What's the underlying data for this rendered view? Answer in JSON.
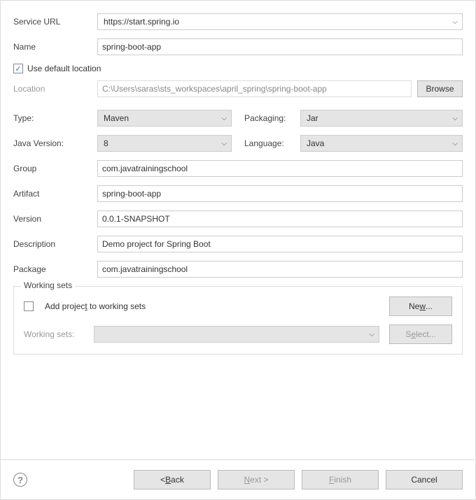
{
  "labels": {
    "serviceUrl": "Service URL",
    "name": "Name",
    "useDefaultLocation": "Use default location",
    "location": "Location",
    "browse": "Browse",
    "type": "Type:",
    "packaging": "Packaging:",
    "javaVersion": "Java Version:",
    "language": "Language:",
    "group": "Group",
    "artifact": "Artifact",
    "version": "Version",
    "description": "Description",
    "package": "Package",
    "workingSets": "Working sets",
    "addToWorkingSets": "Add project to working sets",
    "workingSetsLabel": "Working sets:",
    "new": "New...",
    "select": "Select..."
  },
  "values": {
    "serviceUrl": "https://start.spring.io",
    "name": "spring-boot-app",
    "useDefaultLocation": true,
    "location": "C:\\Users\\saras\\sts_workspaces\\april_spring\\spring-boot-app",
    "type": "Maven",
    "packaging": "Jar",
    "javaVersion": "8",
    "language": "Java",
    "group": "com.javatrainingschool",
    "artifact": "spring-boot-app",
    "version": "0.0.1-SNAPSHOT",
    "description": "Demo project for Spring Boot",
    "package": "com.javatrainingschool",
    "addToWorkingSets": false
  },
  "buttons": {
    "back": "< Back",
    "next": "Next >",
    "finish": "Finish",
    "cancel": "Cancel"
  }
}
